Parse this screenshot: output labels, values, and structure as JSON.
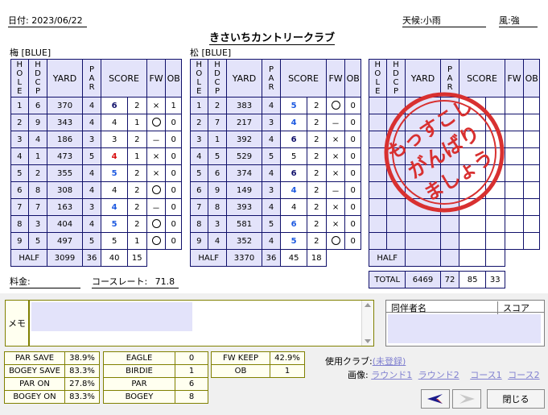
{
  "header": {
    "date_label": "日付:",
    "date_value": "2023/06/22",
    "weather_label": "天候:",
    "weather_value": "小雨",
    "wind_label": "風:",
    "wind_value": "強",
    "club_name": "きさいちカントリークラブ"
  },
  "columns": [
    "HOLE",
    "HDCP",
    "YARD",
    "PAR",
    "SCORE",
    "FW",
    "OB"
  ],
  "out": {
    "tee": "梅 [BLUE]",
    "rows": [
      {
        "hole": "1",
        "hdcp": "6",
        "yard": "370",
        "par": "4",
        "score": "6",
        "putt": "2",
        "fw": "×",
        "ob": "1",
        "color": "K"
      },
      {
        "hole": "2",
        "hdcp": "9",
        "yard": "343",
        "par": "4",
        "score": "4",
        "putt": "1",
        "fw": "○",
        "ob": "0",
        "color": "G"
      },
      {
        "hole": "3",
        "hdcp": "4",
        "yard": "186",
        "par": "3",
        "score": "3",
        "putt": "2",
        "fw": "－",
        "ob": "0",
        "color": "G"
      },
      {
        "hole": "4",
        "hdcp": "1",
        "yard": "473",
        "par": "5",
        "score": "4",
        "putt": "1",
        "fw": "×",
        "ob": "0",
        "color": "R"
      },
      {
        "hole": "5",
        "hdcp": "2",
        "yard": "355",
        "par": "4",
        "score": "5",
        "putt": "2",
        "fw": "×",
        "ob": "0",
        "color": "B"
      },
      {
        "hole": "6",
        "hdcp": "8",
        "yard": "308",
        "par": "4",
        "score": "4",
        "putt": "2",
        "fw": "○",
        "ob": "0",
        "color": "G"
      },
      {
        "hole": "7",
        "hdcp": "7",
        "yard": "163",
        "par": "3",
        "score": "4",
        "putt": "2",
        "fw": "－",
        "ob": "0",
        "color": "B"
      },
      {
        "hole": "8",
        "hdcp": "3",
        "yard": "404",
        "par": "4",
        "score": "5",
        "putt": "2",
        "fw": "○",
        "ob": "0",
        "color": "B"
      },
      {
        "hole": "9",
        "hdcp": "5",
        "yard": "497",
        "par": "5",
        "score": "5",
        "putt": "1",
        "fw": "○",
        "ob": "0",
        "color": "G"
      }
    ],
    "half": {
      "label": "HALF",
      "yard": "3099",
      "par": "36",
      "score": "40",
      "putt": "15"
    }
  },
  "in": {
    "tee": "松 [BLUE]",
    "rows": [
      {
        "hole": "1",
        "hdcp": "2",
        "yard": "383",
        "par": "4",
        "score": "5",
        "putt": "2",
        "fw": "○",
        "ob": "0",
        "color": "B"
      },
      {
        "hole": "2",
        "hdcp": "7",
        "yard": "217",
        "par": "3",
        "score": "4",
        "putt": "2",
        "fw": "－",
        "ob": "0",
        "color": "B"
      },
      {
        "hole": "3",
        "hdcp": "1",
        "yard": "392",
        "par": "4",
        "score": "6",
        "putt": "2",
        "fw": "×",
        "ob": "0",
        "color": "K"
      },
      {
        "hole": "4",
        "hdcp": "5",
        "yard": "529",
        "par": "5",
        "score": "5",
        "putt": "2",
        "fw": "×",
        "ob": "0",
        "color": "G"
      },
      {
        "hole": "5",
        "hdcp": "6",
        "yard": "374",
        "par": "4",
        "score": "6",
        "putt": "2",
        "fw": "×",
        "ob": "0",
        "color": "K"
      },
      {
        "hole": "6",
        "hdcp": "9",
        "yard": "149",
        "par": "3",
        "score": "4",
        "putt": "2",
        "fw": "－",
        "ob": "0",
        "color": "B"
      },
      {
        "hole": "7",
        "hdcp": "8",
        "yard": "393",
        "par": "4",
        "score": "4",
        "putt": "2",
        "fw": "×",
        "ob": "0",
        "color": "G"
      },
      {
        "hole": "8",
        "hdcp": "3",
        "yard": "581",
        "par": "5",
        "score": "6",
        "putt": "2",
        "fw": "×",
        "ob": "0",
        "color": "B"
      },
      {
        "hole": "9",
        "hdcp": "4",
        "yard": "352",
        "par": "4",
        "score": "5",
        "putt": "2",
        "fw": "○",
        "ob": "0",
        "color": "B"
      }
    ],
    "half": {
      "label": "HALF",
      "yard": "3370",
      "par": "36",
      "score": "45",
      "putt": "18"
    }
  },
  "third": {
    "half_label": "HALF",
    "total": {
      "label": "TOTAL",
      "yard": "6469",
      "par": "72",
      "score": "85",
      "putt": "33"
    }
  },
  "stamp": {
    "text": "もっすこしがんばりましょう",
    "line1": "もっすこし",
    "line2": "がんばり",
    "line3": "ましょう",
    "color": "#d83030"
  },
  "fee_label": "料金:",
  "course_rate_label": "コースレート:",
  "course_rate_value": "71.8",
  "memo_label": "メモ",
  "companions": {
    "name_header": "同伴者名",
    "score_header": "スコア"
  },
  "stats1": [
    {
      "label": "PAR SAVE",
      "value": "38.9%"
    },
    {
      "label": "BOGEY SAVE",
      "value": "83.3%"
    },
    {
      "label": "PAR ON",
      "value": "27.8%"
    },
    {
      "label": "BOGEY ON",
      "value": "83.3%"
    }
  ],
  "stats2": [
    {
      "label": "EAGLE",
      "value": "0"
    },
    {
      "label": "BIRDIE",
      "value": "1"
    },
    {
      "label": "PAR",
      "value": "6"
    },
    {
      "label": "BOGEY",
      "value": "8"
    }
  ],
  "stats3": [
    {
      "label": "FW KEEP",
      "value": "42.9%"
    },
    {
      "label": "OB",
      "value": "1"
    }
  ],
  "clubs_label": "使用クラブ:",
  "clubs_link": "(未登録)",
  "images_label": "画像:",
  "image_links": [
    "ラウンド1",
    "ラウンド2",
    "コース1",
    "コース2"
  ],
  "close_label": "閉じる",
  "colors": {
    "grid": "#10106a",
    "blue": "#1e5ae0",
    "red": "#d81010",
    "highlight": "#e3e3fa"
  }
}
